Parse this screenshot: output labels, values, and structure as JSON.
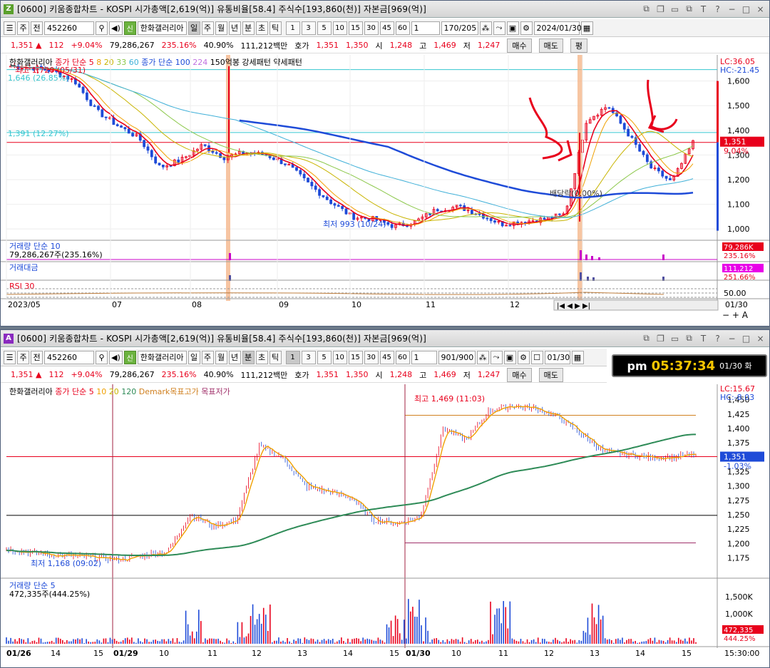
{
  "colors": {
    "up": "#e8001c",
    "down": "#1e4bd8",
    "ma5": "#e8001c",
    "ma8": "#f0a000",
    "ma20": "#c8b400",
    "ma33": "#8cc84b",
    "ma60": "#40b0d8",
    "ma100": "#1e4bd8",
    "ma224": "#c070e0",
    "ma120": "#2e8b57",
    "accent": "#6cb33f"
  },
  "top": {
    "title": "[0600] 키움종합차트 - KOSPI 시가총액[2,619(억)] 유통비율[58.4] 주식수[193,860(천)] 자본금[969(억)]",
    "badge": "Z",
    "toolbar": {
      "type": "주",
      "prev": "전",
      "code": "452260",
      "name": "한화갤러리아",
      "periods": [
        "일",
        "주",
        "월",
        "년",
        "분",
        "초",
        "틱"
      ],
      "selected_period": "일",
      "numbers": [
        "1",
        "3",
        "5",
        "10",
        "15",
        "30",
        "45",
        "60"
      ],
      "unit": "1",
      "counter": "170/205",
      "date": "2024/01/30"
    },
    "legend": {
      "name": "한화갤러리아",
      "ma_label": "종가 단순",
      "ma_periods": [
        "5",
        "8",
        "20",
        "33",
        "60"
      ],
      "ma2_label": "종가 단순",
      "ma2_periods": [
        "100",
        "224"
      ],
      "pattern1": "150억봉 강세패턴",
      "pattern2": "약세패턴"
    },
    "annotations": {
      "high": "최고 1,720 (05/31)",
      "low": "최저 993 (10/24)",
      "level1": "1,646 (26.85%)",
      "level2": "1,391 (12.27%)",
      "dividend": "배당락(0.00%)"
    },
    "right_labels": {
      "lc": "LC:36.05",
      "hc": "HC:-21.45",
      "price": "1,351",
      "pct": "9.04%"
    },
    "y_ticks": [
      "1,600",
      "1,500",
      "1,400",
      "1,300",
      "1,200",
      "1,100",
      "1,000"
    ],
    "volume": {
      "label": "거래량",
      "ma": "단순 10",
      "value": "79,286,267주(235.16%)",
      "right_value": "79,286K",
      "right_pct": "235.16%"
    },
    "amount": {
      "label": "거래대금",
      "right_value": "111,212",
      "right_pct": "251.66%"
    },
    "rsi": {
      "label": "RSI 30",
      "right_value": "50.00"
    },
    "x_ticks": [
      "2023/05",
      "07",
      "08",
      "09",
      "10",
      "11",
      "12",
      "2024/01"
    ],
    "x_right": "01/30"
  },
  "bottom": {
    "title": "[0600] 키움종합차트 - KOSPI 시가총액[2,619(억)] 유통비율[58.4] 주식수[193,860(천)] 자본금[969(억)]",
    "badge": "A",
    "toolbar": {
      "type": "주",
      "prev": "전",
      "code": "452260",
      "name": "한화갤러리아",
      "periods": [
        "일",
        "주",
        "월",
        "년",
        "분",
        "초",
        "틱"
      ],
      "selected_period": "분",
      "numbers": [
        "1",
        "3",
        "5",
        "10",
        "15",
        "30",
        "45",
        "60"
      ],
      "unit": "1",
      "counter": "901/900",
      "date": "01/30"
    },
    "clock": {
      "ampm": "pm",
      "time": "05:37:34",
      "date": "01/30 화"
    },
    "legend": {
      "name": "한화갤러리아",
      "ma_label": "종가 단순",
      "ma_periods": [
        "5",
        "10",
        "20",
        "120"
      ],
      "demark_high": "Demark목표고가",
      "demark_low": "목표저가"
    },
    "annotations": {
      "high": "최고 1,469 (11:03)",
      "low": "최저 1,168 (09:02)"
    },
    "right_labels": {
      "lc": "LC:15.67",
      "hc": "HC:-8.03",
      "price": "1,351",
      "pct": "-1.03%"
    },
    "y_ticks": [
      "1,450",
      "1,425",
      "1,400",
      "1,375",
      "1,350",
      "1,325",
      "1,300",
      "1,275",
      "1,250",
      "1,225",
      "1,200",
      "1,175"
    ],
    "volume": {
      "label": "거래량",
      "ma": "단순 5",
      "value": "472,335주(444.25%)",
      "right_value": "472,335",
      "right_pct": "444.25%",
      "y_ticks": [
        "1,500K",
        "1,000K",
        "500K"
      ]
    },
    "x_ticks": [
      "01/26",
      "14",
      "15",
      "01/29",
      "10",
      "11",
      "12",
      "13",
      "14",
      "15",
      "01/30",
      "10",
      "11",
      "12",
      "13",
      "14",
      "15"
    ],
    "x_right": "15:30:00"
  },
  "quote": {
    "price": "1,351",
    "arrow": "▲",
    "change": "112",
    "pct": "+9.04%",
    "volume": "79,286,267",
    "vol_ratio": "235.16%",
    "turnover": "40.90%",
    "amount": "111,212백만",
    "ask_label": "호가",
    "ask": "1,351",
    "bid": "1,350",
    "open_label": "시",
    "open": "1,248",
    "high_label": "고",
    "high": "1,469",
    "low_label": "저",
    "low": "1,247",
    "buy": "매수",
    "sell": "매도",
    "avg": "평"
  },
  "chart_data": [
    {
      "type": "candlestick",
      "title": "한화갤러리아 일봉",
      "x": [
        "2023/05",
        "07",
        "08",
        "09",
        "10",
        "11",
        "12",
        "2024/01",
        "01/30"
      ],
      "ylim": [
        960,
        1700
      ],
      "high": 1720,
      "low": 993,
      "close": 1351,
      "series": [
        {
          "name": "종가 단순 5"
        },
        {
          "name": "8"
        },
        {
          "name": "20"
        },
        {
          "name": "33"
        },
        {
          "name": "60"
        },
        {
          "name": "100"
        },
        {
          "name": "224"
        }
      ],
      "closes": [
        1660,
        1655,
        1640,
        1600,
        1480,
        1420,
        1370,
        1250,
        1280,
        1340,
        1290,
        1310,
        1300,
        1260,
        1180,
        1110,
        1050,
        1040,
        1010,
        1030,
        1080,
        1090,
        1060,
        1020,
        1030,
        1040,
        1060,
        1440,
        1500,
        1380,
        1250,
        1190,
        1351
      ]
    },
    {
      "type": "candlestick",
      "title": "한화갤러리아 1분봉",
      "x": [
        "01/26",
        "01/29",
        "01/30"
      ],
      "ylim": [
        1160,
        1470
      ],
      "high": 1469,
      "low": 1168,
      "close": 1351,
      "series": [
        {
          "name": "종가 단순 5"
        },
        {
          "name": "10"
        },
        {
          "name": "20"
        },
        {
          "name": "120"
        }
      ],
      "closes": [
        1190,
        1185,
        1180,
        1178,
        1175,
        1172,
        1180,
        1185,
        1250,
        1230,
        1240,
        1370,
        1350,
        1300,
        1290,
        1280,
        1240,
        1235,
        1245,
        1400,
        1380,
        1430,
        1440,
        1435,
        1420,
        1390,
        1360,
        1355,
        1350,
        1350,
        1355
      ]
    }
  ]
}
